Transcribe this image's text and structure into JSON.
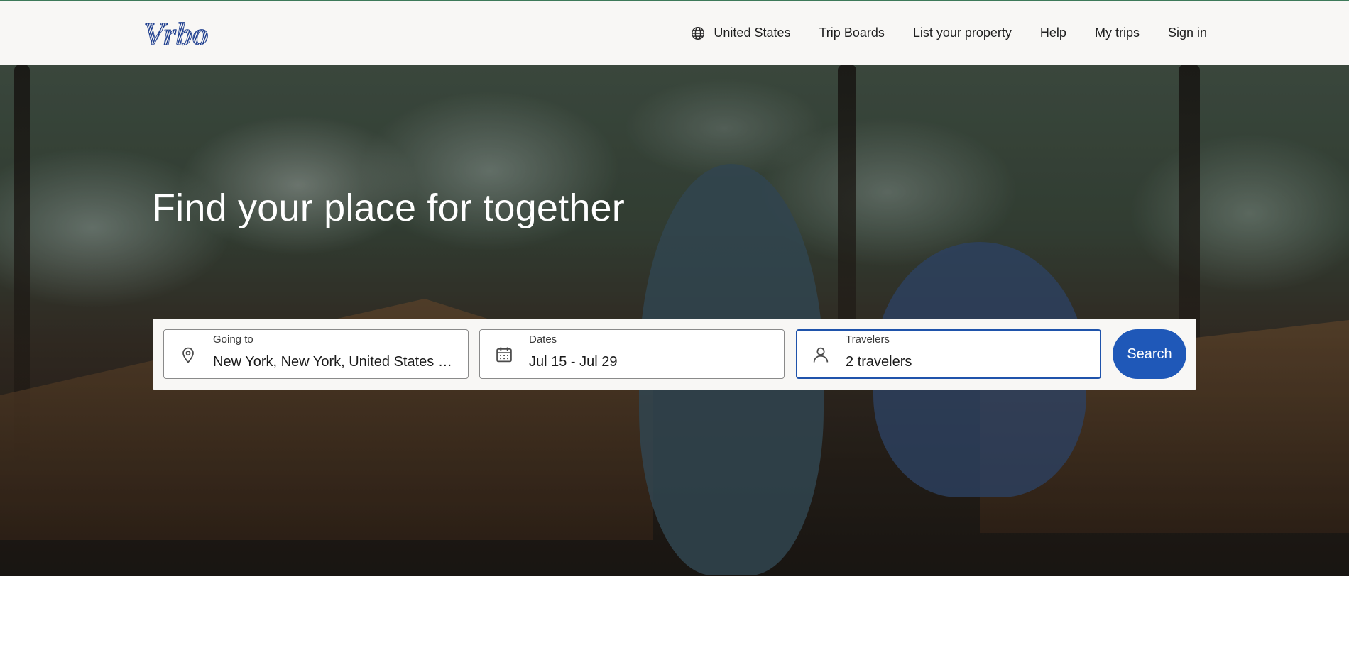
{
  "header": {
    "logo_text": "Vrbo",
    "nav": {
      "region": "United States",
      "trip_boards": "Trip Boards",
      "list_property": "List your property",
      "help": "Help",
      "my_trips": "My trips",
      "sign_in": "Sign in"
    }
  },
  "hero": {
    "headline": "Find your place for together"
  },
  "search": {
    "going_to": {
      "label": "Going to",
      "value": "New York, New York, United States of America",
      "icon": "map-pin-icon"
    },
    "dates": {
      "label": "Dates",
      "value": "Jul 15 - Jul 29",
      "icon": "calendar-icon"
    },
    "travelers": {
      "label": "Travelers",
      "value": "2 travelers",
      "icon": "person-icon"
    },
    "button_label": "Search"
  },
  "colors": {
    "brand_blue": "#1f58b8",
    "logo_blue": "#1f3f8f",
    "active_border": "#1f53ab",
    "header_bg": "#f8f7f5"
  }
}
